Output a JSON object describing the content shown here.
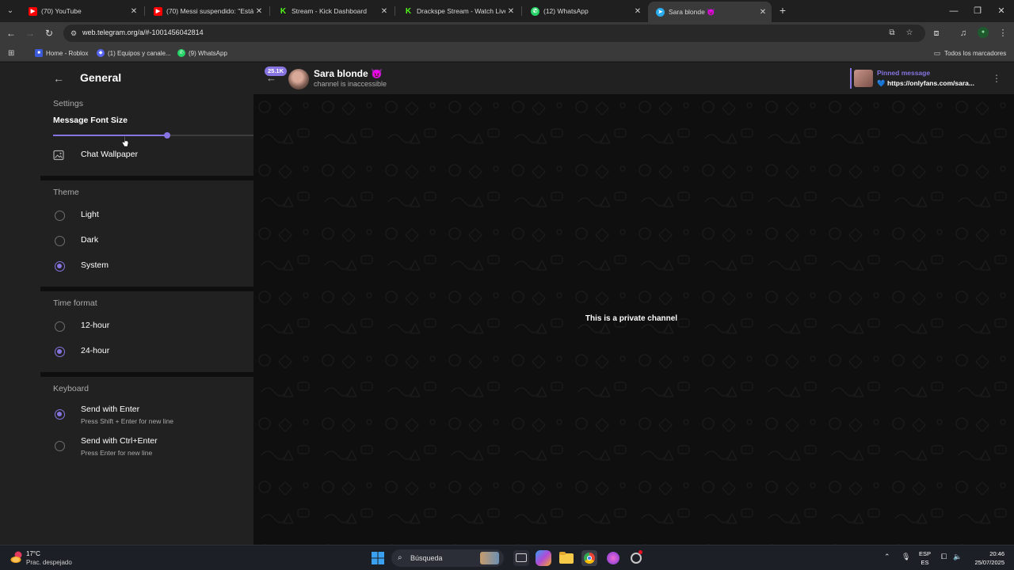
{
  "browser": {
    "tabs": [
      {
        "title": "(70) YouTube",
        "favicon": "youtube-icon",
        "color": "#ff0000"
      },
      {
        "title": "(70) Messi suspendido: \"Está m",
        "favicon": "youtube-icon",
        "color": "#ff0000"
      },
      {
        "title": "Stream - Kick Dashboard",
        "favicon": "kick-icon",
        "color": "#53fc18"
      },
      {
        "title": "Drackspe Stream - Watch Live",
        "favicon": "kick-icon",
        "color": "#53fc18"
      },
      {
        "title": "(12) WhatsApp",
        "favicon": "whatsapp-icon",
        "color": "#25d366"
      },
      {
        "title": "Sara blonde 😈",
        "favicon": "telegram-icon",
        "color": "#2aabee",
        "active": true
      }
    ],
    "url": "web.telegram.org/a/#-1001456042814",
    "bookmarks": [
      {
        "label": "Home - Roblox",
        "icon": "roblox-icon"
      },
      {
        "label": "(1) Equipos y canale...",
        "icon": "discord-icon"
      },
      {
        "label": "(9) WhatsApp",
        "icon": "whatsapp-icon"
      }
    ],
    "all_bookmarks": "Todos los marcadores"
  },
  "settings": {
    "title": "General",
    "settings_section": "Settings",
    "font_size_label": "Message Font Size",
    "font_size_level": 0.57,
    "wallpaper_label": "Chat Wallpaper",
    "theme_section": "Theme",
    "theme_options": [
      "Light",
      "Dark",
      "System"
    ],
    "theme_selected": "System",
    "time_section": "Time format",
    "time_options": [
      "12-hour",
      "24-hour"
    ],
    "time_selected": "24-hour",
    "keyboard_section": "Keyboard",
    "keyboard_options": [
      {
        "label": "Send with Enter",
        "hint": "Press Shift + Enter for new line"
      },
      {
        "label": "Send with Ctrl+Enter",
        "hint": "Press Enter for new line"
      }
    ],
    "keyboard_selected": "Send with Enter",
    "accent_color": "#8774e1"
  },
  "chat": {
    "unread_badge": "25.1K",
    "title": "Sara blonde 😈",
    "subtitle": "channel is inaccessible",
    "pinned_title": "Pinned message",
    "pinned_text": "💙 https://onlyfans.com/sara...",
    "private_message": "This is a private channel"
  },
  "taskbar": {
    "temperature": "17°C",
    "weather": "Prac. despejado",
    "search_placeholder": "Búsqueda",
    "lang_top": "ESP",
    "lang_bottom": "ES",
    "time": "20:46",
    "date": "25/07/2025"
  }
}
